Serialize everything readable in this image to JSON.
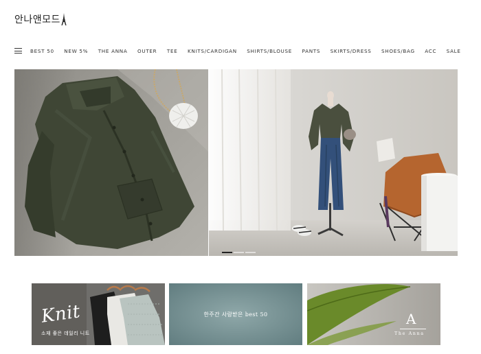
{
  "site": {
    "logo_text": "안나앤모드"
  },
  "nav": {
    "items": [
      {
        "label": "BEST 50"
      },
      {
        "label": "NEW 5%"
      },
      {
        "label": "THE ANNA"
      },
      {
        "label": "OUTER"
      },
      {
        "label": "TEE"
      },
      {
        "label": "KNITS/CARDIGAN"
      },
      {
        "label": "SHIRTS/BLOUSE"
      },
      {
        "label": "PANTS"
      },
      {
        "label": "SKIRTS/DRESS"
      },
      {
        "label": "SHOES/BAG"
      },
      {
        "label": "ACC"
      },
      {
        "label": "SALE"
      }
    ]
  },
  "hero": {
    "slide_count": 3,
    "active_slide": 1
  },
  "banners": [
    {
      "script": "Knit",
      "caption": "소재 좋은 데일리 니트"
    },
    {
      "caption": "한주간 사랑받은 best 50"
    },
    {
      "letter": "A",
      "name": "The Anna"
    }
  ],
  "colors": {
    "jacket": "#3f4635",
    "floor_left": "#9b9a94",
    "wall_right": "#d6d3cd",
    "accent_chair": "#b5652f"
  }
}
